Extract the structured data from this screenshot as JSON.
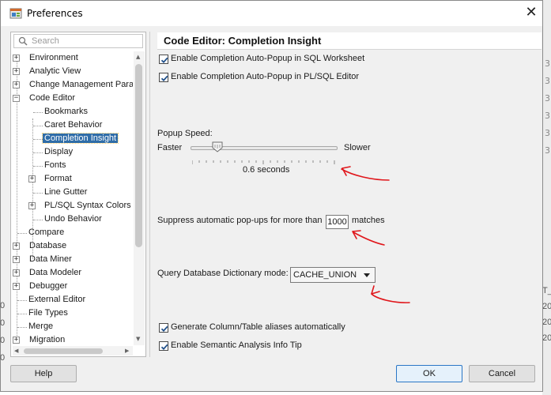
{
  "window": {
    "title": "Preferences",
    "close_glyph": "✕"
  },
  "search": {
    "placeholder": "Search"
  },
  "tree": {
    "items": [
      {
        "label": "Environment",
        "expander": "+"
      },
      {
        "label": "Analytic View",
        "expander": "+"
      },
      {
        "label": "Change Management Parar",
        "expander": "+"
      },
      {
        "label": "Code Editor",
        "expander": "−"
      },
      {
        "label": "Bookmarks",
        "expander": ""
      },
      {
        "label": "Caret Behavior",
        "expander": ""
      },
      {
        "label": "Completion Insight",
        "expander": "",
        "selected": true
      },
      {
        "label": "Display",
        "expander": ""
      },
      {
        "label": "Fonts",
        "expander": ""
      },
      {
        "label": "Format",
        "expander": "+"
      },
      {
        "label": "Line Gutter",
        "expander": ""
      },
      {
        "label": "PL/SQL Syntax Colors",
        "expander": "+"
      },
      {
        "label": "Undo Behavior",
        "expander": ""
      },
      {
        "label": "Compare",
        "expander": ""
      },
      {
        "label": "Database",
        "expander": "+"
      },
      {
        "label": "Data Miner",
        "expander": "+"
      },
      {
        "label": "Data Modeler",
        "expander": "+"
      },
      {
        "label": "Debugger",
        "expander": "+"
      },
      {
        "label": "External Editor",
        "expander": ""
      },
      {
        "label": "File Types",
        "expander": ""
      },
      {
        "label": "Merge",
        "expander": ""
      },
      {
        "label": "Migration",
        "expander": "+"
      }
    ]
  },
  "panel": {
    "heading": "Code Editor: Completion Insight",
    "auto_popup_sql": {
      "label": "Enable Completion Auto-Popup in SQL Worksheet",
      "checked": true
    },
    "auto_popup_plsql": {
      "label": "Enable Completion Auto-Popup in PL/SQL Editor",
      "checked": true
    },
    "popup_speed": {
      "label": "Popup Speed:",
      "min_label": "Faster",
      "max_label": "Slower",
      "value_text": "0.6 seconds"
    },
    "suppress": {
      "prefix": "Suppress automatic pop-ups for more than",
      "value": "1000",
      "suffix": "matches"
    },
    "dictionary_mode": {
      "label": "Query Database Dictionary mode:",
      "selected": "CACHE_UNION"
    },
    "gen_aliases": {
      "label": "Generate Column/Table aliases automatically",
      "checked": true
    },
    "semantic_tip": {
      "label": "Enable Semantic Analysis Info Tip",
      "checked": true
    }
  },
  "buttons": {
    "help": "Help",
    "ok": "OK",
    "cancel": "Cancel"
  },
  "background": {
    "right_digits": [
      "3",
      "3",
      "3",
      "3",
      "3",
      "3"
    ],
    "left_digits": [
      "0",
      "0",
      "0",
      "0"
    ],
    "right_lower": [
      "T_",
      "20",
      "20",
      "20"
    ]
  },
  "colors": {
    "selection": "#2f6da8",
    "annotation": "#e0161b",
    "primary_border": "#2b77c6"
  }
}
